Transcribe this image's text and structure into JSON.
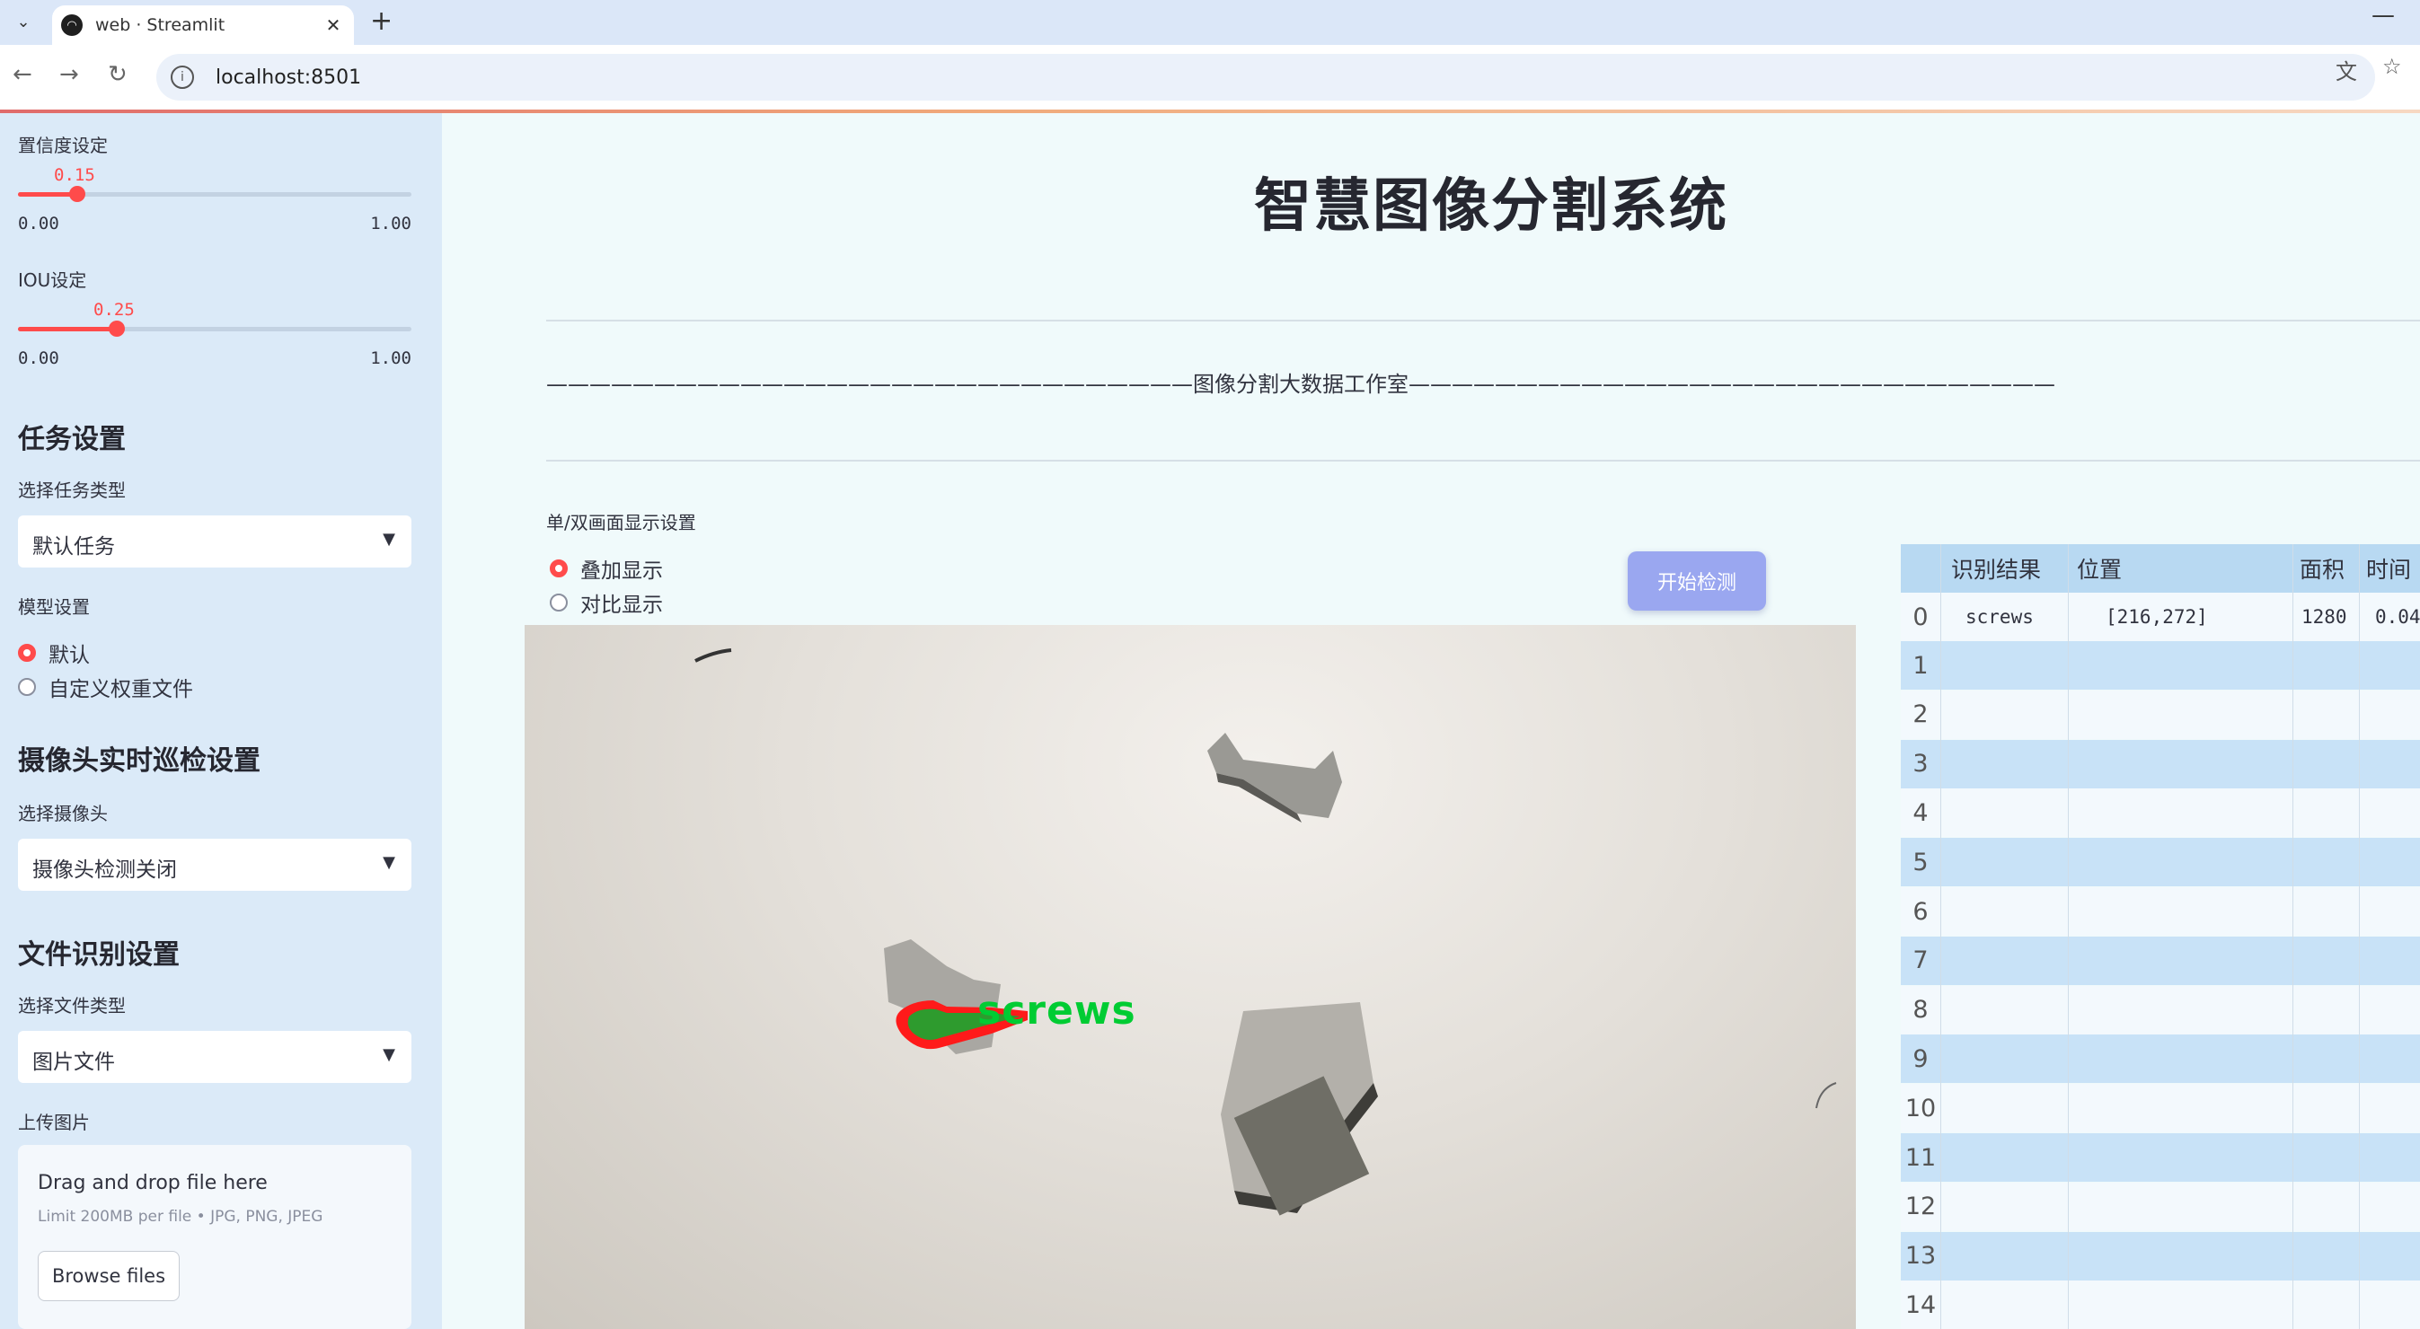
{
  "browser": {
    "tab_title": "web · Streamlit",
    "url": "localhost:8501"
  },
  "sidebar": {
    "confidence": {
      "label": "置信度设定",
      "value": "0.15",
      "fraction": 0.15,
      "min": "0.00",
      "max": "1.00"
    },
    "iou": {
      "label": "IOU设定",
      "value": "0.25",
      "fraction": 0.25,
      "min": "0.00",
      "max": "1.00"
    },
    "task_section": "任务设置",
    "task_type_label": "选择任务类型",
    "task_type_value": "默认任务",
    "model_label": "模型设置",
    "model_options": [
      "默认",
      "自定义权重文件"
    ],
    "camera_section": "摄像头实时巡检设置",
    "camera_label": "选择摄像头",
    "camera_value": "摄像头检测关闭",
    "file_section": "文件识别设置",
    "file_type_label": "选择文件类型",
    "file_type_value": "图片文件",
    "upload_label": "上传图片",
    "upload_drop": "Drag and drop file here",
    "upload_limit": "Limit 200MB per file • JPG, PNG, JPEG",
    "upload_button": "Browse files"
  },
  "main": {
    "title": "智慧图像分割系统",
    "subtitle": "——————————————————————————————图像分割大数据工作室——————————————————————————————",
    "display_mode_label": "单/双画面显示设置",
    "display_options": [
      "叠加显示",
      "对比显示"
    ],
    "start_button": "开始检测",
    "detection_label": "screws"
  },
  "table": {
    "headers": [
      "识别结果",
      "位置",
      "面积",
      "时间"
    ],
    "row0": {
      "index": "0",
      "result": "screws",
      "position": "[216,272]",
      "area": "1280",
      "time": "0.04"
    },
    "indices": [
      "1",
      "2",
      "3",
      "4",
      "5",
      "6",
      "7",
      "8",
      "9",
      "10",
      "11",
      "12",
      "13",
      "14"
    ]
  },
  "colors": {
    "accent": "#ff4b4b",
    "detection": "#00cc33",
    "mask": "#ff1a1a",
    "button": "#9aa7f0"
  }
}
